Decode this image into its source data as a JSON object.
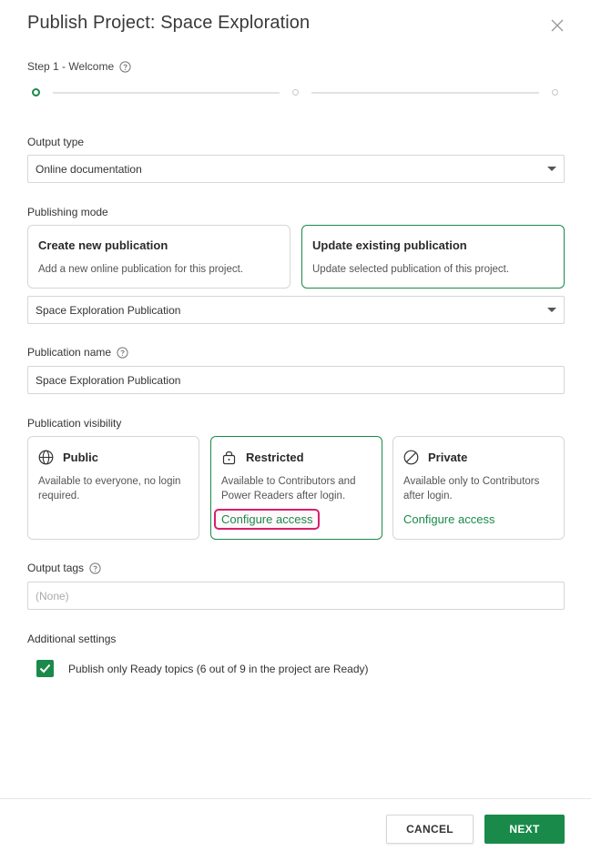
{
  "dialog": {
    "title": "Publish Project: Space Exploration"
  },
  "stepper": {
    "label": "Step 1 - Welcome",
    "steps": 3,
    "current": 1
  },
  "output_type": {
    "label": "Output type",
    "value": "Online documentation"
  },
  "publishing_mode": {
    "label": "Publishing mode",
    "options": [
      {
        "title": "Create new publication",
        "desc": "Add a new online publication for this project."
      },
      {
        "title": "Update existing publication",
        "desc": "Update selected publication of this project."
      }
    ],
    "selected_publication": "Space Exploration Publication"
  },
  "publication_name": {
    "label": "Publication name",
    "value": "Space Exploration Publication"
  },
  "visibility": {
    "label": "Publication visibility",
    "options": [
      {
        "title": "Public",
        "desc": "Available to everyone, no login required.",
        "icon": "globe-icon"
      },
      {
        "title": "Restricted",
        "desc": "Available to Contributors and Power Readers after login.",
        "icon": "lock-icon",
        "link": "Configure access"
      },
      {
        "title": "Private",
        "desc": "Available only to Contributors after login.",
        "icon": "blocked-icon",
        "link": "Configure access"
      }
    ]
  },
  "output_tags": {
    "label": "Output tags",
    "placeholder": "(None)"
  },
  "additional": {
    "label": "Additional settings",
    "checkbox_label": "Publish only Ready topics (6 out of 9 in the project are Ready)",
    "checked": true
  },
  "footer": {
    "cancel_label": "CANCEL",
    "next_label": "NEXT"
  },
  "colors": {
    "accent": "#1a8a4a",
    "highlight": "#d8206a"
  }
}
